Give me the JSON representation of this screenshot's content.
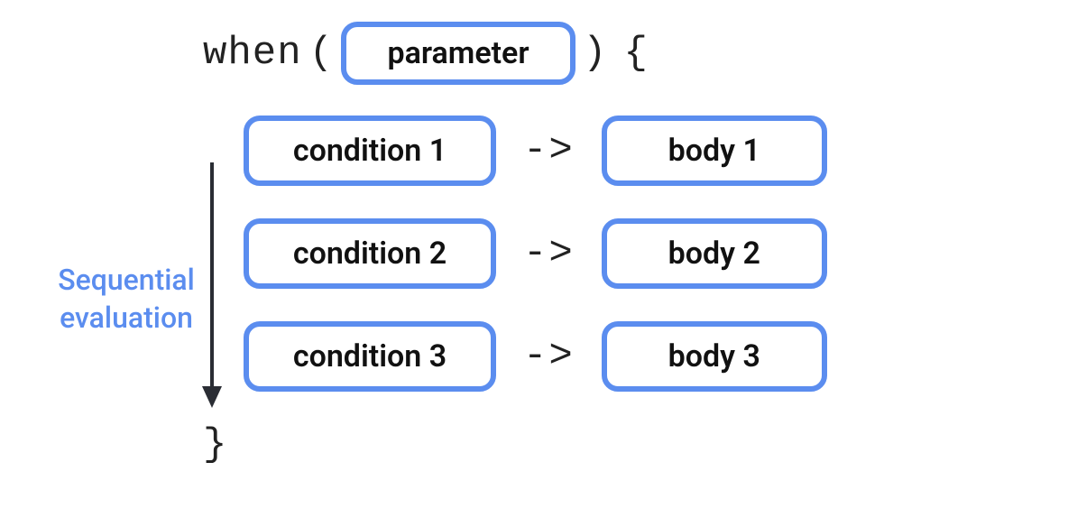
{
  "keyword": "when",
  "openParen": "(",
  "closeParen": ")",
  "openBrace": "{",
  "closeBrace": "}",
  "parameter": "parameter",
  "arrowSymbol": "->",
  "branches": [
    {
      "condition": "condition 1",
      "body": "body 1"
    },
    {
      "condition": "condition 2",
      "body": "body 2"
    },
    {
      "condition": "condition 3",
      "body": "body 3"
    }
  ],
  "sideLabel": "Sequential evaluation",
  "colors": {
    "pillBorder": "#5b8def",
    "text": "#111",
    "label": "#5b8def"
  }
}
